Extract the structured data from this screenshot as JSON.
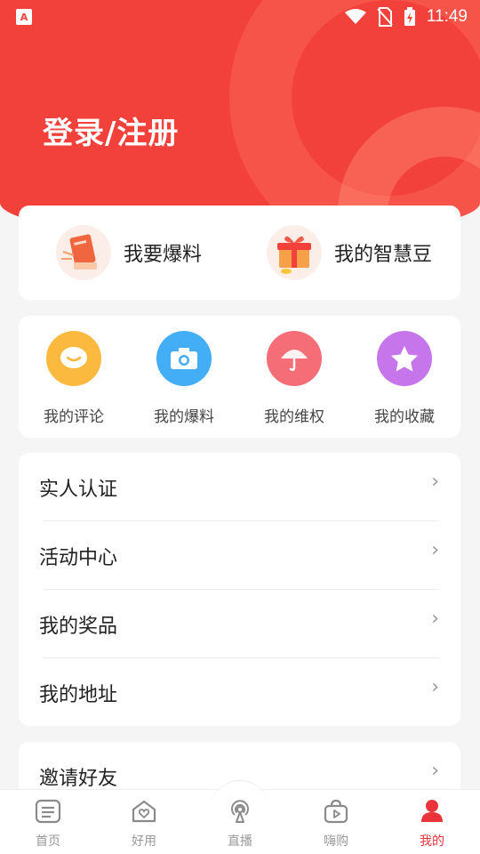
{
  "status": {
    "time": "11:49",
    "app_badge": "A"
  },
  "header": {
    "login_title": "登录/注册"
  },
  "top_actions": [
    {
      "label": "我要爆料",
      "icon": "book-megaphone-icon"
    },
    {
      "label": "我的智慧豆",
      "icon": "gift-box-icon"
    }
  ],
  "quick_actions": [
    {
      "label": "我的评论",
      "icon": "comment-smile-icon",
      "color": "#fbb93a"
    },
    {
      "label": "我的爆料",
      "icon": "camera-icon",
      "color": "#3aa9f5"
    },
    {
      "label": "我的维权",
      "icon": "umbrella-icon",
      "color": "#f26a75"
    },
    {
      "label": "我的收藏",
      "icon": "star-icon",
      "color": "#c36ee8"
    }
  ],
  "menu": [
    {
      "label": "实人认证"
    },
    {
      "label": "活动中心"
    },
    {
      "label": "我的奖品"
    },
    {
      "label": "我的地址"
    }
  ],
  "invite": {
    "label": "邀请好友"
  },
  "tabs": [
    {
      "label": "首页",
      "icon": "home-list-icon",
      "active": false
    },
    {
      "label": "好用",
      "icon": "house-heart-icon",
      "active": false
    },
    {
      "label": "直播",
      "icon": "broadcast-icon",
      "active": false
    },
    {
      "label": "嗨购",
      "icon": "shopping-bag-play-icon",
      "active": false
    },
    {
      "label": "我的",
      "icon": "profile-icon",
      "active": true
    }
  ],
  "colors": {
    "brand_red": "#f2413a",
    "active_tab": "#e8343a"
  }
}
